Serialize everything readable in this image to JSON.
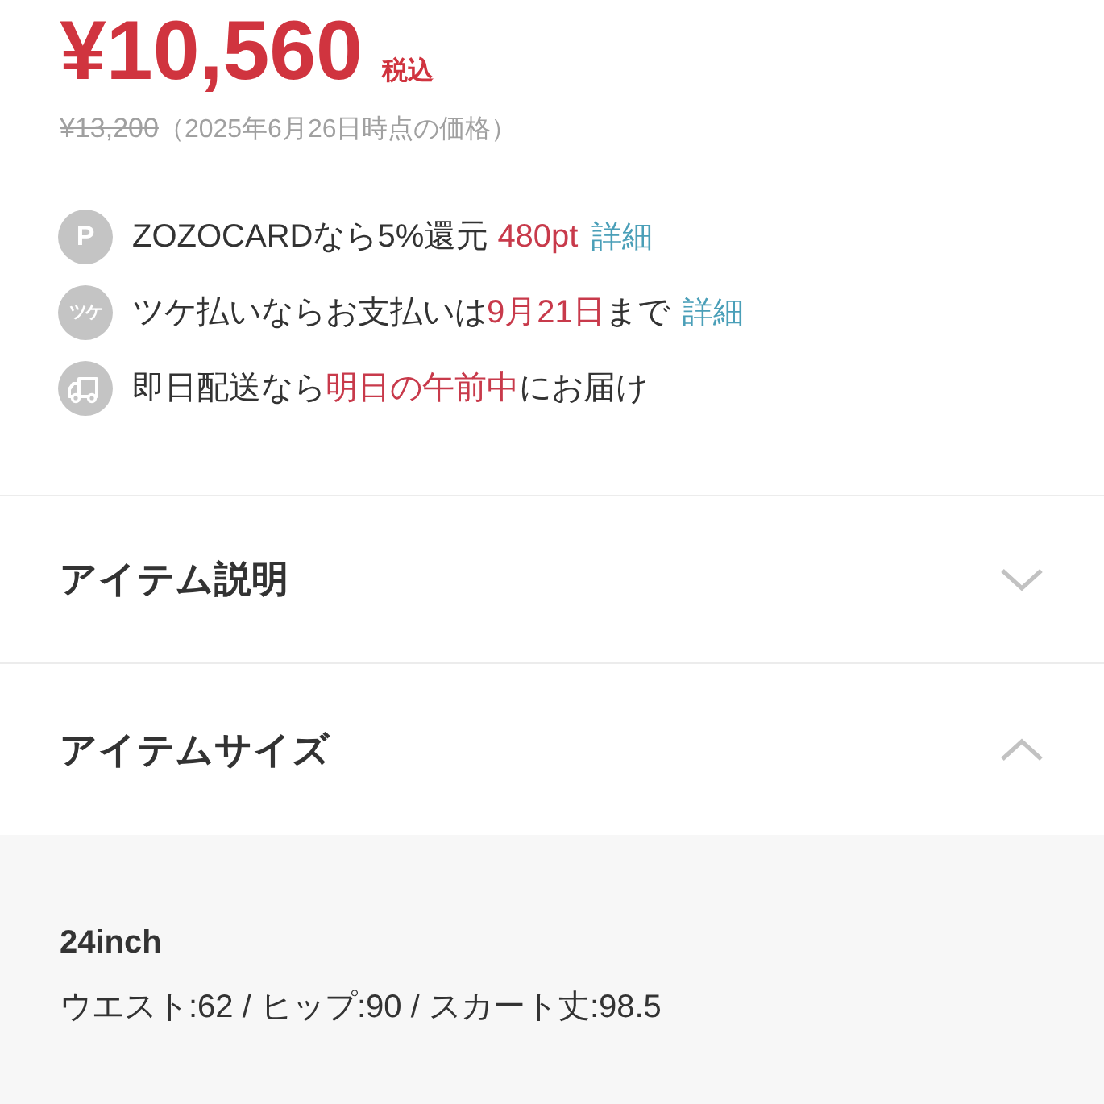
{
  "price": {
    "amount": "¥10,560",
    "tax_label": "税込",
    "original_price": "¥13,200",
    "price_note": "（2025年6月26日時点の価格）"
  },
  "benefits": [
    {
      "kind": "letter",
      "badge_text": "P",
      "segments": [
        {
          "text": "ZOZOCARDなら5%還元 ",
          "highlight": false
        },
        {
          "text": "480pt",
          "highlight": true
        }
      ],
      "link": "詳細"
    },
    {
      "kind": "letter",
      "badge_text": "ツケ",
      "segments": [
        {
          "text": "ツケ払いならお支払いは",
          "highlight": false
        },
        {
          "text": "9月21日",
          "highlight": true
        },
        {
          "text": "まで",
          "highlight": false
        }
      ],
      "link": "詳細"
    },
    {
      "kind": "truck",
      "segments": [
        {
          "text": "即日配送なら",
          "highlight": false
        },
        {
          "text": "明日の午前中",
          "highlight": true
        },
        {
          "text": "にお届け",
          "highlight": false
        }
      ]
    }
  ],
  "accordions": [
    {
      "title": "アイテム説明",
      "expanded": false
    },
    {
      "title": "アイテムサイズ",
      "expanded": true,
      "sizes": [
        {
          "name": "24inch",
          "measurements": "ウエスト:62 / ヒップ:90 / スカート丈:98.5"
        }
      ]
    }
  ]
}
